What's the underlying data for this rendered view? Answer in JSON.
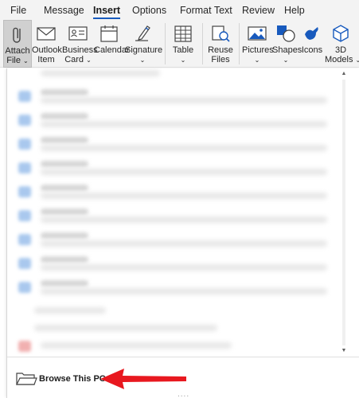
{
  "menu": {
    "tabs": [
      "File",
      "Message",
      "Insert",
      "Options",
      "Format Text",
      "Review",
      "Help"
    ],
    "active_tab": "Insert"
  },
  "ribbon": {
    "attach_file": {
      "line1": "Attach",
      "line2": "File"
    },
    "outlook_item": {
      "line1": "Outlook",
      "line2": "Item"
    },
    "business_card": {
      "line1": "Business",
      "line2": "Card"
    },
    "calendar": {
      "line1": "Calendar"
    },
    "signature": {
      "line1": "Signature"
    },
    "table": {
      "line1": "Table"
    },
    "reuse_files": {
      "line1": "Reuse",
      "line2": "Files"
    },
    "pictures": {
      "line1": "Pictures"
    },
    "shapes": {
      "line1": "Shapes"
    },
    "icons": {
      "line1": "Icons"
    },
    "models_3d": {
      "line1": "3D",
      "line2": "Models"
    }
  },
  "attach_menu": {
    "browse_label": "Browse This PC...",
    "grip": "....",
    "recent_items_blurred": true
  },
  "colors": {
    "accent": "#185abd",
    "ribbon_bg": "#f3f3f3",
    "arrow": "#e8181f",
    "file_icon": "#a9c8ee"
  },
  "icons": {
    "attach": "paperclip-icon",
    "outlook_item": "envelope-icon",
    "business_card": "contact-card-icon",
    "calendar": "calendar-icon",
    "signature": "signature-pen-icon",
    "table": "table-grid-icon",
    "reuse": "reuse-files-icon",
    "pictures": "picture-icon",
    "shapes": "shapes-icon",
    "icons": "icons-bird-icon",
    "models": "cube-icon",
    "browse": "folder-icon"
  }
}
